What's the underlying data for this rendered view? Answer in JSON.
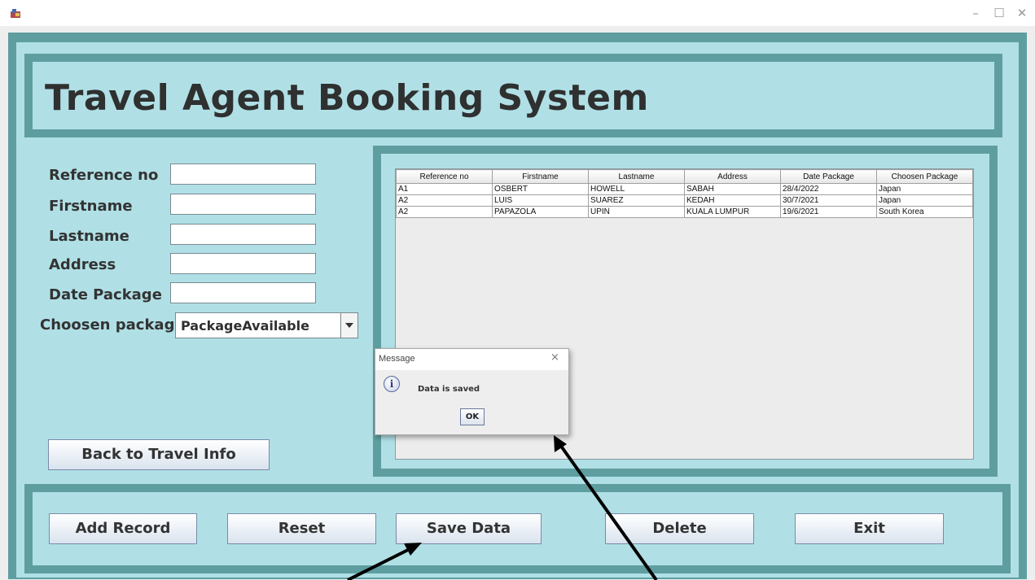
{
  "window": {
    "icon": "java-app-icon",
    "controls": {
      "minimize": "–",
      "maximize": "☐",
      "close": "✕"
    }
  },
  "header": {
    "title": "Travel Agent Booking System"
  },
  "form": {
    "reference_label": "Reference no",
    "reference_value": "",
    "firstname_label": "Firstname",
    "firstname_value": "",
    "lastname_label": "Lastname",
    "lastname_value": "",
    "address_label": "Address",
    "address_value": "",
    "date_label": "Date Package",
    "date_value": "",
    "package_label": "Choosen package",
    "package_selected": "PackageAvailable",
    "back_button": "Back to Travel Info"
  },
  "table": {
    "headers": [
      "Reference no",
      "Firstname",
      "Lastname",
      "Address",
      "Date Package",
      "Choosen Package"
    ],
    "rows": [
      [
        "A1",
        "OSBERT",
        "HOWELL",
        "SABAH",
        "28/4/2022",
        "Japan"
      ],
      [
        "A2",
        "LUIS",
        "SUAREZ",
        "KEDAH",
        "30/7/2021",
        "Japan"
      ],
      [
        "A2",
        "PAPAZOLA",
        "UPIN",
        "KUALA LUMPUR",
        "19/6/2021",
        "South Korea"
      ]
    ]
  },
  "dialog": {
    "title": "Message",
    "close": "×",
    "icon": "info-icon",
    "message": "Data is saved",
    "ok": "OK"
  },
  "actions": {
    "add": "Add Record",
    "reset": "Reset",
    "save": "Save Data",
    "delete": "Delete",
    "exit": "Exit"
  },
  "colors": {
    "panel_border": "#5f9ea0",
    "panel_fill": "#b0e0e6",
    "title_text": "#2f3030"
  }
}
